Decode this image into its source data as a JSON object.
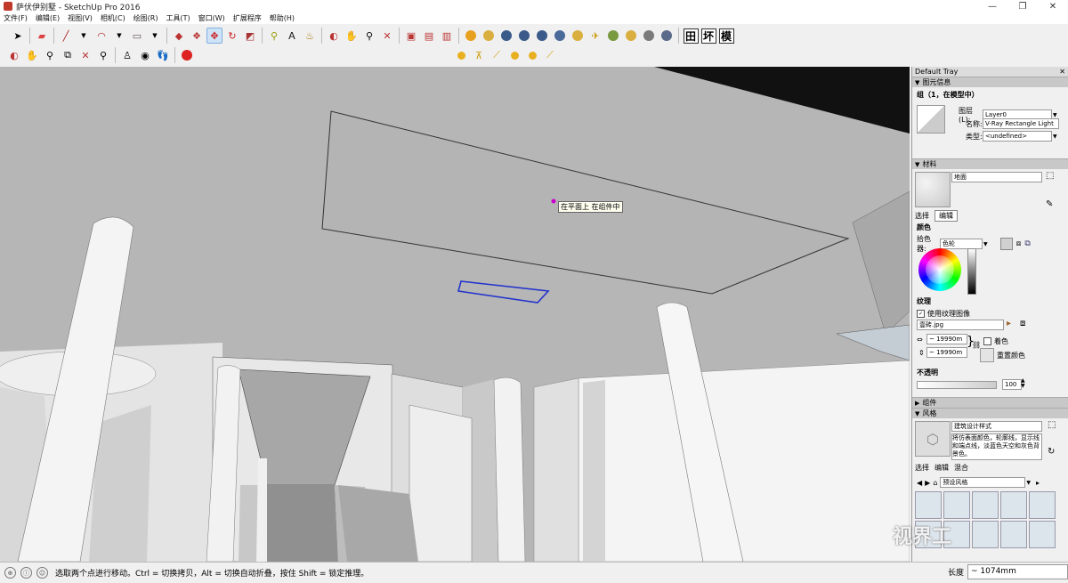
{
  "window": {
    "title": "萨伏伊别墅 - SketchUp Pro 2016",
    "controls": [
      "—",
      "❐",
      "✕"
    ]
  },
  "menu": [
    "文件(F)",
    "编辑(E)",
    "视图(V)",
    "相机(C)",
    "绘图(R)",
    "工具(T)",
    "窗口(W)",
    "扩展程序",
    "帮助(H)"
  ],
  "toolbar": {
    "text_buttons": [
      "田",
      "坏",
      "模"
    ]
  },
  "viewport": {
    "tooltip": "在平面上 在组件中",
    "sky_color": "#b5b5b5",
    "selection_color": "#2233cc"
  },
  "tray": {
    "title": "Default Tray",
    "entity_info": {
      "header": "图元信息",
      "subtitle": "组（1，在模型中）",
      "layer_label": "图层(L):",
      "layer_value": "Layer0",
      "name_label": "名称:",
      "name_value": "V-Ray Rectangle Light",
      "type_label": "类型:",
      "type_value": "<undefined>"
    },
    "materials": {
      "header": "材料",
      "material_name": "地面",
      "tabs": [
        "选择",
        "编辑"
      ],
      "color_section": "颜色",
      "picker_label": "拾色器:",
      "picker_value": "色轮",
      "texture_section": "纹理",
      "use_texture_label": "使用纹理图像",
      "texture_file": "壹砖.jpg",
      "width_value": "~ 19990m",
      "height_value": "~ 19990m",
      "colorize_label": "着色",
      "reset_color_label": "重置颜色",
      "opacity_section": "不透明",
      "opacity_value": "100"
    },
    "components": {
      "header": "组件"
    },
    "styles": {
      "header": "风格",
      "style_name": "建筑设计样式",
      "style_desc": "将仿表面颜色，轮廓线，显示线和端点线，淡蓝色天空和灰色背景色。",
      "tabs": [
        "选择",
        "编辑",
        "混合"
      ],
      "dropdown": "预设风格"
    }
  },
  "status": {
    "hint": "选取两个点进行移动。Ctrl = 切换拷贝，Alt = 切换自动折叠，按住 Shift = 锁定推理。",
    "measure_label": "长度",
    "measure_value": "~ 1074mm"
  },
  "watermark": "视界工"
}
